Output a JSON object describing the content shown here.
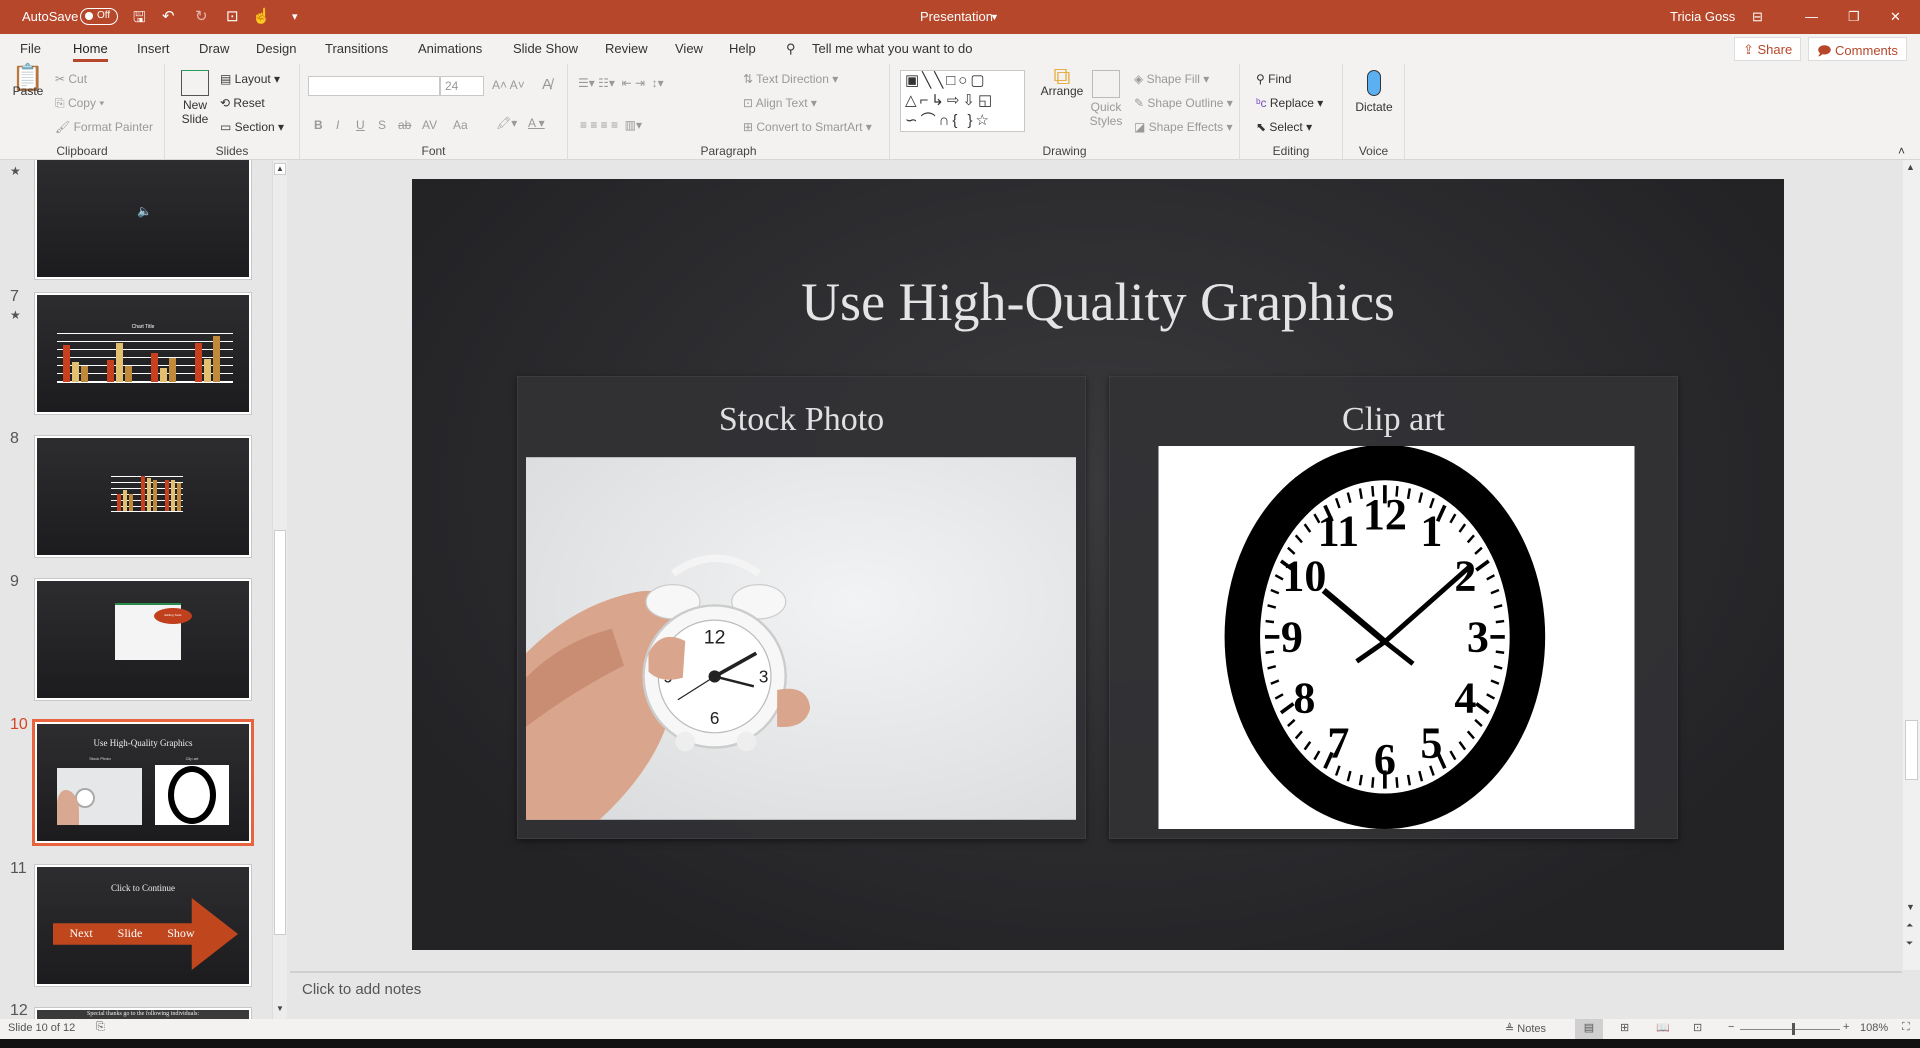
{
  "titlebar": {
    "autosave": "AutoSave",
    "toggle": "Off",
    "doc_title": "Presentation",
    "user": "Tricia Goss",
    "accent": "#b7472a"
  },
  "tabs": [
    "File",
    "Home",
    "Insert",
    "Draw",
    "Design",
    "Transitions",
    "Animations",
    "Slide Show",
    "Review",
    "View",
    "Help"
  ],
  "active_tab": "Home",
  "tell_me": "Tell me what you want to do",
  "share": "Share",
  "comments": "Comments",
  "ribbon": {
    "clipboard": {
      "label": "Clipboard",
      "paste": "Paste",
      "cut": "Cut",
      "copy": "Copy",
      "format_painter": "Format Painter"
    },
    "slides": {
      "label": "Slides",
      "new_slide_1": "New",
      "new_slide_2": "Slide",
      "layout": "Layout",
      "reset": "Reset",
      "section": "Section"
    },
    "font": {
      "label": "Font",
      "font_name": "",
      "font_size": "24",
      "bold": "B",
      "italic": "I",
      "underline": "U",
      "shadow": "S",
      "strike": "ab",
      "spacing": "AV",
      "case": "Aa"
    },
    "paragraph": {
      "label": "Paragraph",
      "text_direction": "Text Direction",
      "align_text": "Align Text",
      "convert": "Convert to SmartArt"
    },
    "drawing": {
      "label": "Drawing",
      "arrange": "Arrange",
      "quick_1": "Quick",
      "quick_2": "Styles",
      "shape_fill": "Shape Fill",
      "shape_outline": "Shape Outline",
      "shape_effects": "Shape Effects"
    },
    "editing": {
      "label": "Editing",
      "find": "Find",
      "replace": "Replace",
      "select": "Select"
    },
    "voice": {
      "label": "Voice",
      "dictate": "Dictate"
    }
  },
  "thumbnails": [
    {
      "num": "",
      "star": true
    },
    {
      "num": "7",
      "star": true,
      "title": "Chart Title"
    },
    {
      "num": "8"
    },
    {
      "num": "9",
      "callout": "Editing Tools"
    },
    {
      "num": "10",
      "title": "Use High-Quality Graphics",
      "left": "Stock Photo",
      "right": "Clip art",
      "selected": true
    },
    {
      "num": "11",
      "title": "Click to Continue",
      "arrow": [
        "Next",
        "Slide",
        "Show"
      ]
    },
    {
      "num": "12",
      "title": "Special thanks go to the following individuals:"
    }
  ],
  "slide": {
    "title": "Use High-Quality Graphics",
    "left_heading": "Stock Photo",
    "right_heading": "Clip art",
    "clock_numbers": [
      "12",
      "1",
      "2",
      "3",
      "4",
      "5",
      "6",
      "7",
      "8",
      "9",
      "10",
      "11"
    ]
  },
  "notes_placeholder": "Click to add notes",
  "status": {
    "slide": "Slide 10 of 12",
    "notes": "Notes",
    "zoom": "108%",
    "zoom_level": 108
  }
}
